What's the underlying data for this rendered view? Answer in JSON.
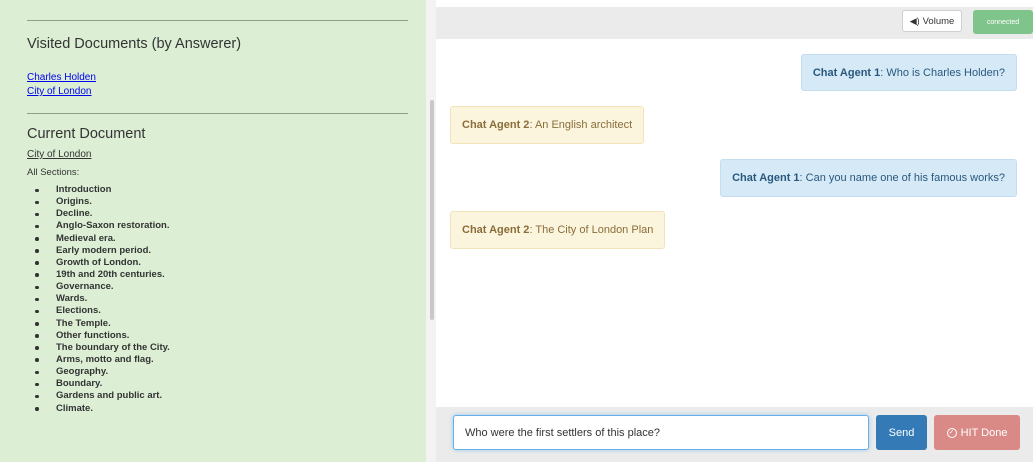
{
  "left_panel": {
    "visited_title": "Visited Documents (by Answerer)",
    "visited_links": [
      "Charles Holden",
      "City of London"
    ],
    "current_title": "Current Document",
    "current_doc_link": "City of London",
    "all_sections_label": "All Sections:",
    "sections": [
      "Introduction",
      "Origins.",
      "Decline.",
      "Anglo-Saxon restoration.",
      "Medieval era.",
      "Early modern period.",
      "Growth of London.",
      "19th and 20th centuries.",
      "Governance.",
      "Wards.",
      "Elections.",
      "The Temple.",
      "Other functions.",
      "The boundary of the City.",
      "Arms, motto and flag.",
      "Geography.",
      "Boundary.",
      "Gardens and public art.",
      "Climate."
    ]
  },
  "top_bar": {
    "volume_icon": "speaker-icon",
    "volume_label": "Volume",
    "status_label": "connected"
  },
  "messages": [
    {
      "speaker": "Chat Agent 1",
      "text": ": Who is Charles Holden?"
    },
    {
      "speaker": "Chat Agent 2",
      "text": ": An English architect"
    },
    {
      "speaker": "Chat Agent 1",
      "text": ": Can you name one of his famous works?"
    },
    {
      "speaker": "Chat Agent 2",
      "text": ": The City of London Plan"
    }
  ],
  "input": {
    "value": "Who were the first settlers of this place?"
  },
  "buttons": {
    "send_label": "Send",
    "hit_done_icon": "check-circle-icon",
    "hit_done_label": "HIT Done"
  },
  "colors": {
    "left_panel_bg": "#dcefd5",
    "agent1_bubble": "#d6e9f7",
    "agent2_bubble": "#fcf5dd",
    "send_button": "#337ab7",
    "hit_done_button": "#d98a86",
    "connected_badge": "#7fc48a"
  }
}
